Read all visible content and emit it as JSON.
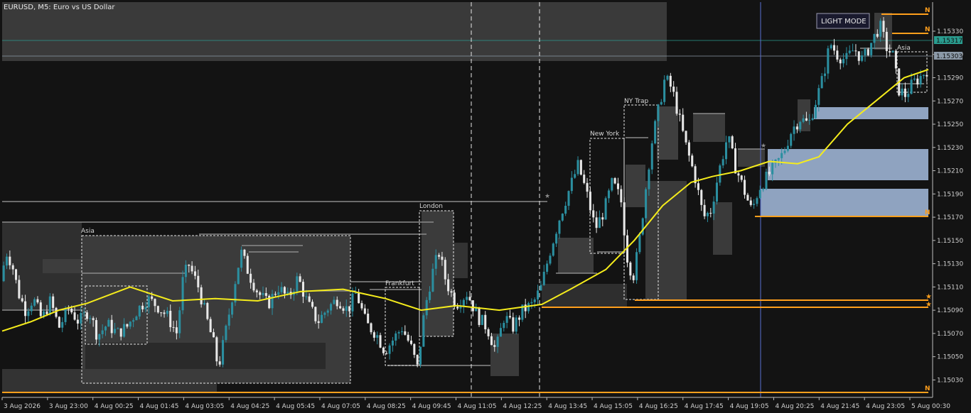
{
  "header": {
    "title": "EURUSD, M5:  Euro vs US Dollar"
  },
  "light_mode_button": {
    "label": "LIGHT MODE"
  },
  "colors": {
    "background": "#131313",
    "bull": "#2b8fa0",
    "bear": "#e8e8e8",
    "ma": "#f5ec1c",
    "orange": "#ff9f1c",
    "zone_blue": "#8fa3c0",
    "box_gray": "#3d3d3d",
    "bid_tag": "#2a9d8f",
    "ask_tag": "#8c9aa8"
  },
  "chart_data": {
    "type": "candlestick",
    "symbol": "EURUSD",
    "timeframe": "M5",
    "ylim": [
      1.15015,
      1.15355
    ],
    "y_ticks": [
      "1.15330",
      "1.15310",
      "1.15290",
      "1.15270",
      "1.15250",
      "1.15230",
      "1.15210",
      "1.15190",
      "1.15170",
      "1.15150",
      "1.15130",
      "1.15110",
      "1.15090",
      "1.15070",
      "1.15050",
      "1.15030"
    ],
    "x_ticks": [
      "3 Aug 2026",
      "3 Aug 23:00",
      "4 Aug 00:25",
      "4 Aug 01:45",
      "4 Aug 03:05",
      "4 Aug 04:25",
      "4 Aug 05:45",
      "4 Aug 07:05",
      "4 Aug 08:25",
      "4 Aug 09:45",
      "4 Aug 11:05",
      "4 Aug 12:25",
      "4 Aug 13:45",
      "4 Aug 15:05",
      "4 Aug 16:25",
      "4 Aug 17:45",
      "4 Aug 19:05",
      "4 Aug 20:25",
      "4 Aug 21:45",
      "4 Aug 23:05",
      "5 Aug 00:30"
    ],
    "price_tags": {
      "bid": "1.15317",
      "ask": "1.15303"
    },
    "sessions": [
      "Asia",
      "London",
      "Frankfurt",
      "New York",
      "NY Trap",
      "Asia"
    ],
    "markers": {
      "level": "N"
    },
    "close_path": [
      [
        0,
        1.15115
      ],
      [
        8,
        1.1514
      ],
      [
        16,
        1.1513
      ],
      [
        25,
        1.15105
      ],
      [
        35,
        1.1509
      ],
      [
        46,
        1.151
      ],
      [
        58,
        1.15082
      ],
      [
        70,
        1.15098
      ],
      [
        82,
        1.15075
      ],
      [
        96,
        1.15092
      ],
      [
        110,
        1.1508
      ],
      [
        124,
        1.1509
      ],
      [
        136,
        1.15068
      ],
      [
        150,
        1.15078
      ],
      [
        164,
        1.1507
      ],
      [
        178,
        1.15076
      ],
      [
        192,
        1.1509
      ],
      [
        206,
        1.151
      ],
      [
        220,
        1.15094
      ],
      [
        234,
        1.15085
      ],
      [
        248,
        1.1507
      ],
      [
        256,
        1.15115
      ],
      [
        264,
        1.1513
      ],
      [
        278,
        1.1511
      ],
      [
        290,
        1.15082
      ],
      [
        300,
        1.1506
      ],
      [
        306,
        1.1504
      ],
      [
        316,
        1.1507
      ],
      [
        328,
        1.1511
      ],
      [
        338,
        1.1514
      ],
      [
        350,
        1.1512
      ],
      [
        362,
        1.15105
      ],
      [
        376,
        1.15095
      ],
      [
        390,
        1.1511
      ],
      [
        404,
        1.151
      ],
      [
        418,
        1.15118
      ],
      [
        432,
        1.15095
      ],
      [
        446,
        1.1508
      ],
      [
        460,
        1.15092
      ],
      [
        474,
        1.151
      ],
      [
        488,
        1.1509
      ],
      [
        500,
        1.15105
      ],
      [
        514,
        1.15078
      ],
      [
        528,
        1.1507
      ],
      [
        540,
        1.15055
      ],
      [
        552,
        1.15065
      ],
      [
        564,
        1.15075
      ],
      [
        576,
        1.1506
      ],
      [
        586,
        1.1504
      ],
      [
        596,
        1.1509
      ],
      [
        606,
        1.1512
      ],
      [
        616,
        1.1514
      ],
      [
        626,
        1.15115
      ],
      [
        640,
        1.15095
      ],
      [
        656,
        1.15105
      ],
      [
        670,
        1.15085
      ],
      [
        684,
        1.15075
      ],
      [
        696,
        1.15055
      ],
      [
        708,
        1.15085
      ],
      [
        720,
        1.15075
      ],
      [
        734,
        1.1509
      ],
      [
        748,
        1.15095
      ],
      [
        760,
        1.1511
      ],
      [
        772,
        1.1514
      ],
      [
        786,
        1.1517
      ],
      [
        800,
        1.15195
      ],
      [
        812,
        1.15215
      ],
      [
        824,
        1.1519
      ],
      [
        836,
        1.1516
      ],
      [
        848,
        1.15175
      ],
      [
        860,
        1.152
      ],
      [
        872,
        1.15185
      ],
      [
        882,
        1.1513
      ],
      [
        890,
        1.1512
      ],
      [
        898,
        1.1515
      ],
      [
        906,
        1.1519
      ],
      [
        914,
        1.1523
      ],
      [
        924,
        1.1526
      ],
      [
        934,
        1.1529
      ],
      [
        944,
        1.1528
      ],
      [
        954,
        1.15255
      ],
      [
        964,
        1.1523
      ],
      [
        976,
        1.15205
      ],
      [
        988,
        1.1517
      ],
      [
        998,
        1.15175
      ],
      [
        1010,
        1.1521
      ],
      [
        1022,
        1.1524
      ],
      [
        1032,
        1.15215
      ],
      [
        1044,
        1.15195
      ],
      [
        1056,
        1.15175
      ],
      [
        1066,
        1.15195
      ],
      [
        1078,
        1.15205
      ],
      [
        1090,
        1.15215
      ],
      [
        1100,
        1.15225
      ],
      [
        1112,
        1.15245
      ],
      [
        1124,
        1.15255
      ],
      [
        1136,
        1.1525
      ],
      [
        1146,
        1.1527
      ],
      [
        1156,
        1.1529
      ],
      [
        1166,
        1.1532
      ],
      [
        1176,
        1.1531
      ],
      [
        1188,
        1.15305
      ],
      [
        1200,
        1.15315
      ],
      [
        1212,
        1.15305
      ],
      [
        1224,
        1.1532
      ],
      [
        1236,
        1.15335
      ],
      [
        1246,
        1.15315
      ],
      [
        1254,
        1.1531
      ],
      [
        1262,
        1.1528
      ],
      [
        1272,
        1.15275
      ],
      [
        1282,
        1.15285
      ],
      [
        1292,
        1.1529
      ],
      [
        1302,
        1.15297
      ]
    ],
    "moving_average": [
      [
        0,
        1.15072
      ],
      [
        40,
        1.1508
      ],
      [
        80,
        1.1509
      ],
      [
        120,
        1.15096
      ],
      [
        180,
        1.1511
      ],
      [
        240,
        1.15098
      ],
      [
        300,
        1.151
      ],
      [
        360,
        1.15098
      ],
      [
        420,
        1.15106
      ],
      [
        480,
        1.15108
      ],
      [
        540,
        1.151
      ],
      [
        590,
        1.1509
      ],
      [
        640,
        1.15094
      ],
      [
        700,
        1.1509
      ],
      [
        760,
        1.15095
      ],
      [
        800,
        1.15108
      ],
      [
        850,
        1.15125
      ],
      [
        890,
        1.1515
      ],
      [
        930,
        1.1518
      ],
      [
        970,
        1.152
      ],
      [
        1000,
        1.15205
      ],
      [
        1040,
        1.1521
      ],
      [
        1080,
        1.15218
      ],
      [
        1120,
        1.15216
      ],
      [
        1150,
        1.15222
      ],
      [
        1190,
        1.1525
      ],
      [
        1230,
        1.1527
      ],
      [
        1270,
        1.1529
      ],
      [
        1304,
        1.15297
      ]
    ]
  }
}
